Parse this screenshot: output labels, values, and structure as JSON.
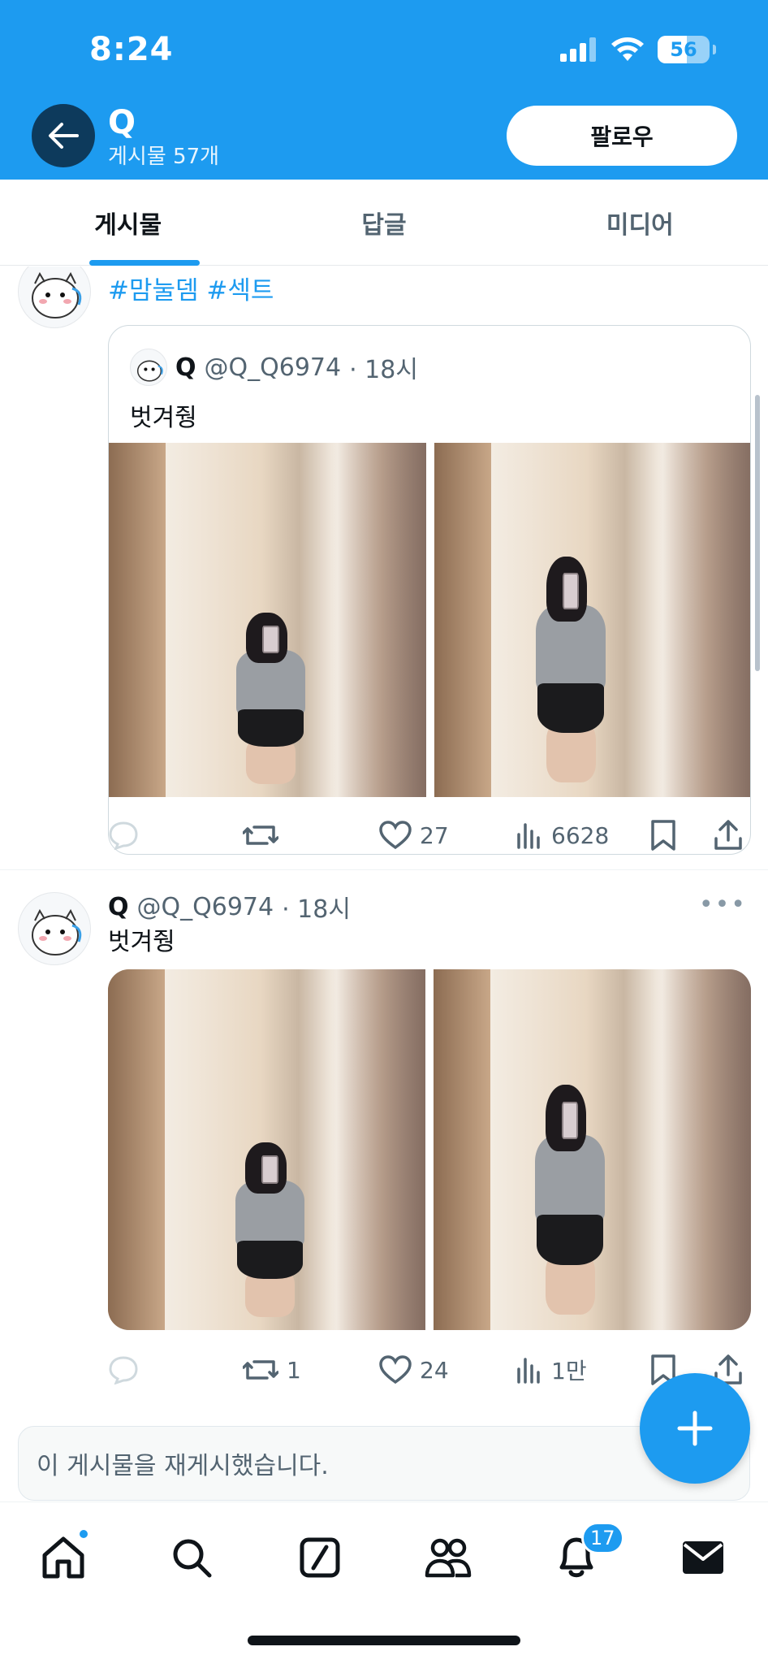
{
  "status_bar": {
    "time": "8:24",
    "battery": "56"
  },
  "header": {
    "name": "Q",
    "post_count": "게시물 57개",
    "follow_label": "팔로우"
  },
  "tabs": [
    {
      "label": "게시물",
      "active": true
    },
    {
      "label": "답글",
      "active": false
    },
    {
      "label": "미디어",
      "active": false
    }
  ],
  "feed": {
    "quote_post": {
      "hashtags": "#맘눌뎀 #섹트",
      "quoted": {
        "name": "Q",
        "handle": "@Q_Q6974",
        "time": "· 18시",
        "text": "벗겨줭"
      },
      "actions": {
        "reply": "",
        "retweet": "",
        "likes": "27",
        "views": "6628"
      }
    },
    "post": {
      "name": "Q",
      "handle": "@Q_Q6974",
      "time": "· 18시",
      "more": "•••",
      "text": "벗겨줭",
      "actions": {
        "reply": "",
        "retweet": "1",
        "likes": "24",
        "views": "1만"
      }
    },
    "repost_banner": "이 게시물을 재게시했습니다."
  },
  "bottom_nav": {
    "items": [
      "home-icon",
      "search-icon",
      "grok-icon",
      "communities-icon",
      "notifications-icon",
      "messages-icon"
    ],
    "notifications_count": "17"
  },
  "colors": {
    "brand": "#1d9bf0",
    "text": "#0f1419",
    "muted": "#536471"
  }
}
